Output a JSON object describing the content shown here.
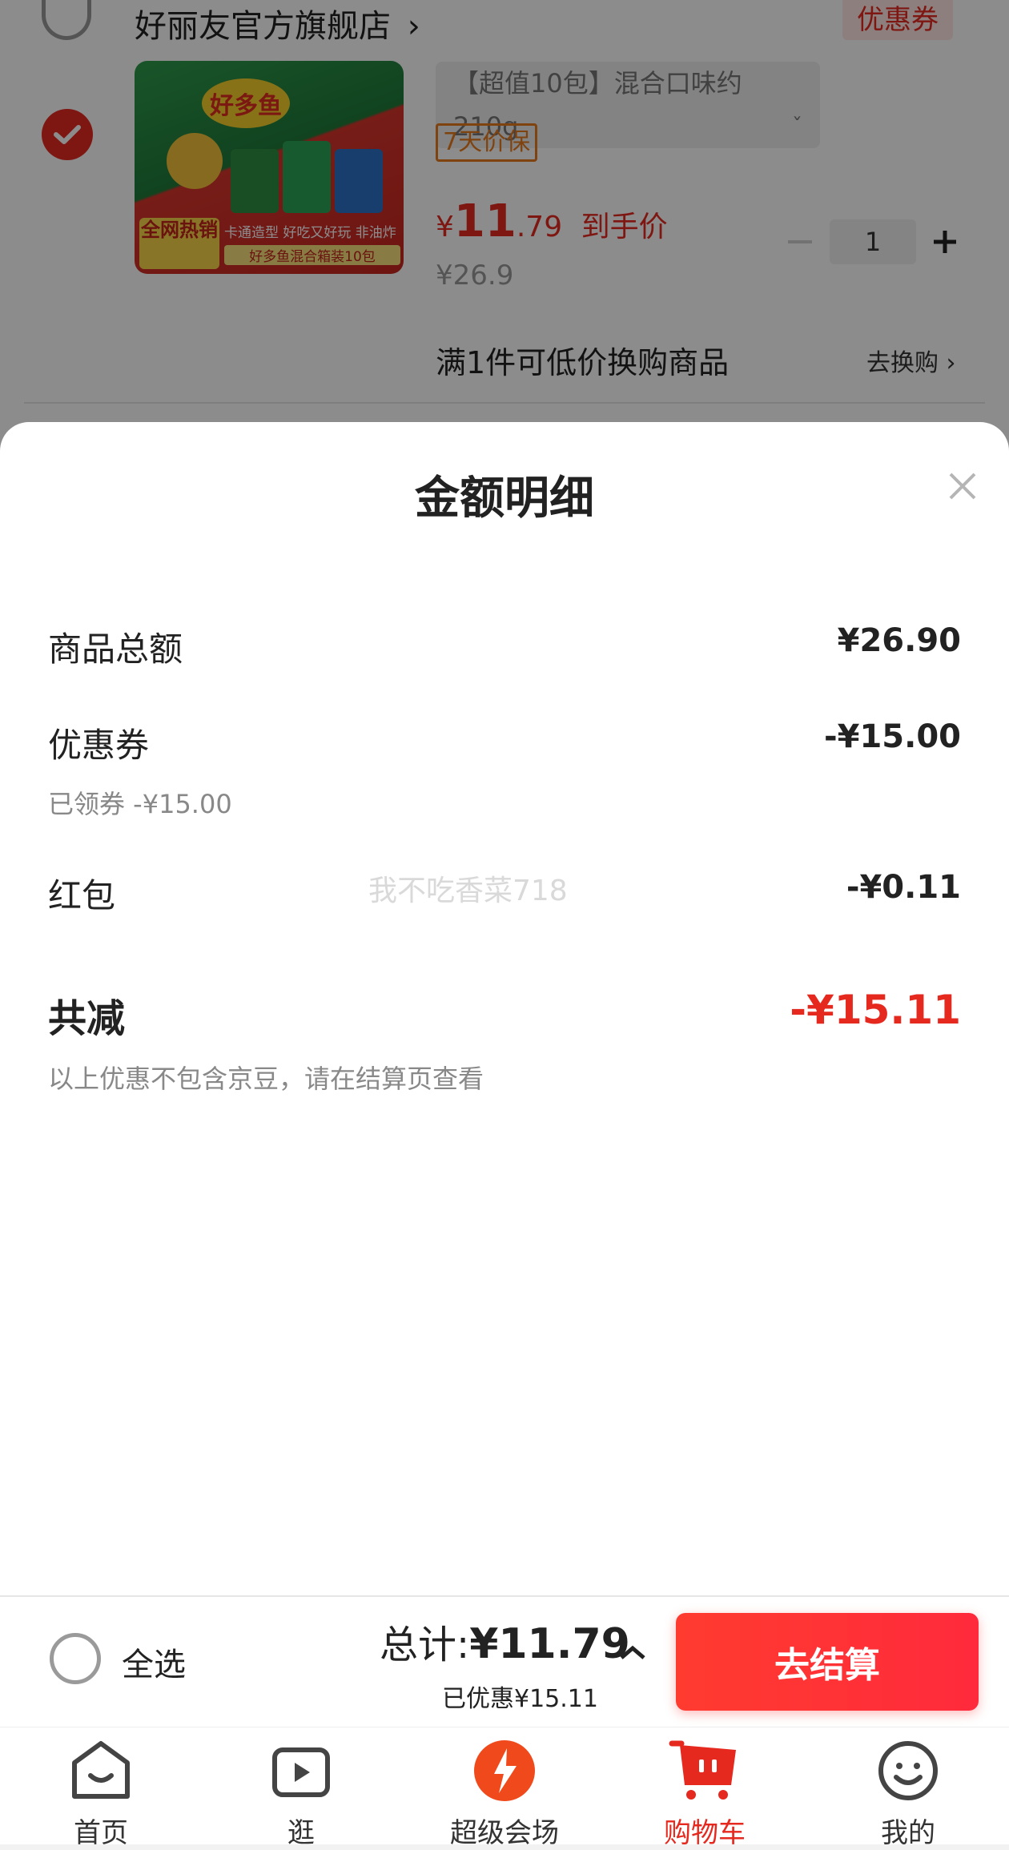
{
  "shop": {
    "name": "好丽友官方旗舰店",
    "chevron": "›",
    "coupon_label": "优惠券"
  },
  "product": {
    "variant": "【超值10包】混合口味约210g",
    "price_guard": "7天价保",
    "price_currency": "¥",
    "price_int": "11",
    "price_dec": ".79",
    "price_suffix": "到手价",
    "original_price": "¥26.9",
    "quantity": "1",
    "image_text_1": "全网热销",
    "image_text_2": "卡通造型 好吃又好玩 非油炸",
    "image_text_3": "好多鱼混合箱装10包",
    "image_brand": "好多鱼"
  },
  "swap": {
    "text": "满1件可低价换购商品",
    "link": "去换购"
  },
  "sheet": {
    "title": "金额明细",
    "rows": [
      {
        "label": "商品总额",
        "value": "¥26.90"
      },
      {
        "label": "优惠券",
        "value": "-¥15.00",
        "note": "已领券 -¥15.00"
      },
      {
        "label": "红包",
        "value": "-¥0.11"
      }
    ],
    "total_label": "共减",
    "total_value": "-¥15.11",
    "disclaimer": "以上优惠不包含京豆，请在结算页查看",
    "watermark": "我不吃香菜718"
  },
  "checkout": {
    "select_all": "全选",
    "total_label": "总计:",
    "total_value": "¥11.79",
    "saved": "已优惠¥15.11",
    "button": "去结算"
  },
  "tabs": [
    {
      "label": "首页",
      "icon": "home-icon"
    },
    {
      "label": "逛",
      "icon": "video-play-icon"
    },
    {
      "label": "超级会场",
      "icon": "super-venue-icon"
    },
    {
      "label": "购物车",
      "icon": "cart-icon",
      "active": true
    },
    {
      "label": "我的",
      "icon": "smiley-profile-icon"
    }
  ],
  "colors": {
    "accent": "#e5291f",
    "overlay": "rgba(0,0,0,0.45)"
  }
}
